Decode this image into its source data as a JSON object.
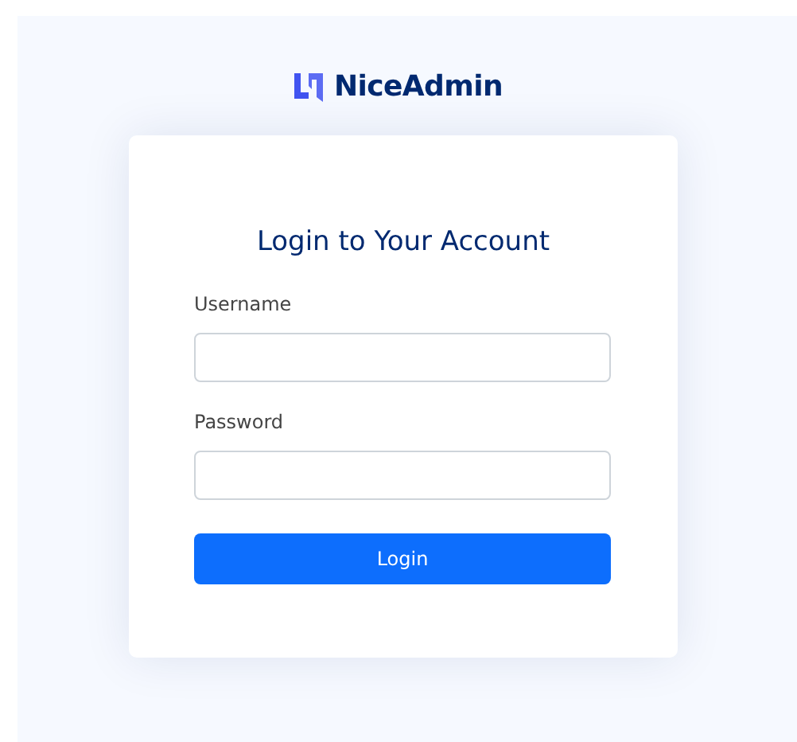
{
  "brand": {
    "name": "NiceAdmin"
  },
  "card": {
    "title": "Login to Your Account",
    "fields": [
      {
        "label": "Username"
      },
      {
        "label": "Password"
      }
    ],
    "button": "Login"
  }
}
